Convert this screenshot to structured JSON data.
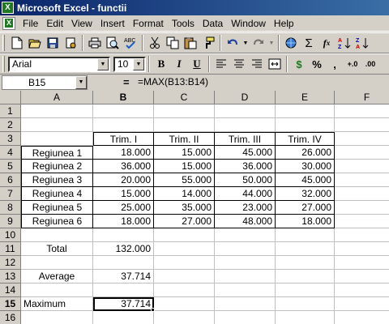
{
  "window": {
    "title": "Microsoft Excel - functii"
  },
  "menu": [
    "File",
    "Edit",
    "View",
    "Insert",
    "Format",
    "Tools",
    "Data",
    "Window",
    "Help"
  ],
  "format_toolbar": {
    "font": "Arial",
    "size": "10",
    "bold": "B",
    "italic": "I",
    "underline": "U",
    "currency": "$",
    "percent": "%",
    "comma": ",",
    "inc_decimal": "+.0",
    "dec_decimal": ".00"
  },
  "formula_bar": {
    "name_box": "B15",
    "equals": "=",
    "formula": "=MAX(B13:B14)"
  },
  "columns": [
    "A",
    "B",
    "C",
    "D",
    "E",
    "F"
  ],
  "rows": [
    "1",
    "2",
    "3",
    "4",
    "5",
    "6",
    "7",
    "8",
    "9",
    "10",
    "11",
    "12",
    "13",
    "14",
    "15",
    "16"
  ],
  "sheet": {
    "headers": [
      "Trim. I",
      "Trim. II",
      "Trim. III",
      "Trim. IV"
    ],
    "regions": [
      {
        "name": "Regiunea 1",
        "values": [
          "18.000",
          "15.000",
          "45.000",
          "26.000"
        ]
      },
      {
        "name": "Regiunea 2",
        "values": [
          "36.000",
          "15.000",
          "36.000",
          "30.000"
        ]
      },
      {
        "name": "Regiunea 3",
        "values": [
          "20.000",
          "55.000",
          "50.000",
          "45.000"
        ]
      },
      {
        "name": "Regiunea 4",
        "values": [
          "15.000",
          "14.000",
          "44.000",
          "32.000"
        ]
      },
      {
        "name": "Regiunea 5",
        "values": [
          "25.000",
          "35.000",
          "23.000",
          "27.000"
        ]
      },
      {
        "name": "Regiunea 6",
        "values": [
          "18.000",
          "27.000",
          "48.000",
          "18.000"
        ]
      }
    ],
    "total_label": "Total",
    "total_value": "132.000",
    "average_label": "Average",
    "average_value": "37.714",
    "maximum_label": "Maximum",
    "maximum_value": "37.714"
  }
}
